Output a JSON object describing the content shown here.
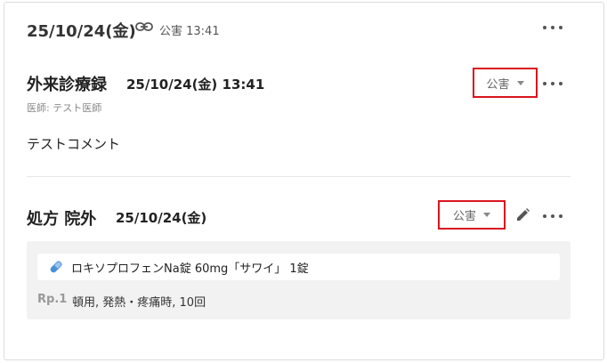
{
  "header": {
    "date": "25/10/24(金)",
    "link_icon": "link-icon",
    "meta": "公害 13:41",
    "more_icon": "more-horizontal-icon"
  },
  "record": {
    "title": "外来診療録",
    "datetime": "25/10/24(金) 13:41",
    "doctor": "医師: テスト医師",
    "comment": "テストコメント",
    "dropdown_value": "公害"
  },
  "prescription": {
    "title": "処方 院外",
    "date": "25/10/24(金)",
    "dropdown_value": "公害",
    "medicine": {
      "icon": "pill-icon",
      "name": "ロキソプロフェンNa錠 60mg「サワイ」 1錠"
    },
    "rp_label": "Rp.1",
    "usage": "頓用, 発熱・疼痛時, 10回"
  },
  "colors": {
    "highlight_border": "#d9141e",
    "pill_icon": "#4a90d9",
    "box_bg": "#f2f2f2"
  }
}
